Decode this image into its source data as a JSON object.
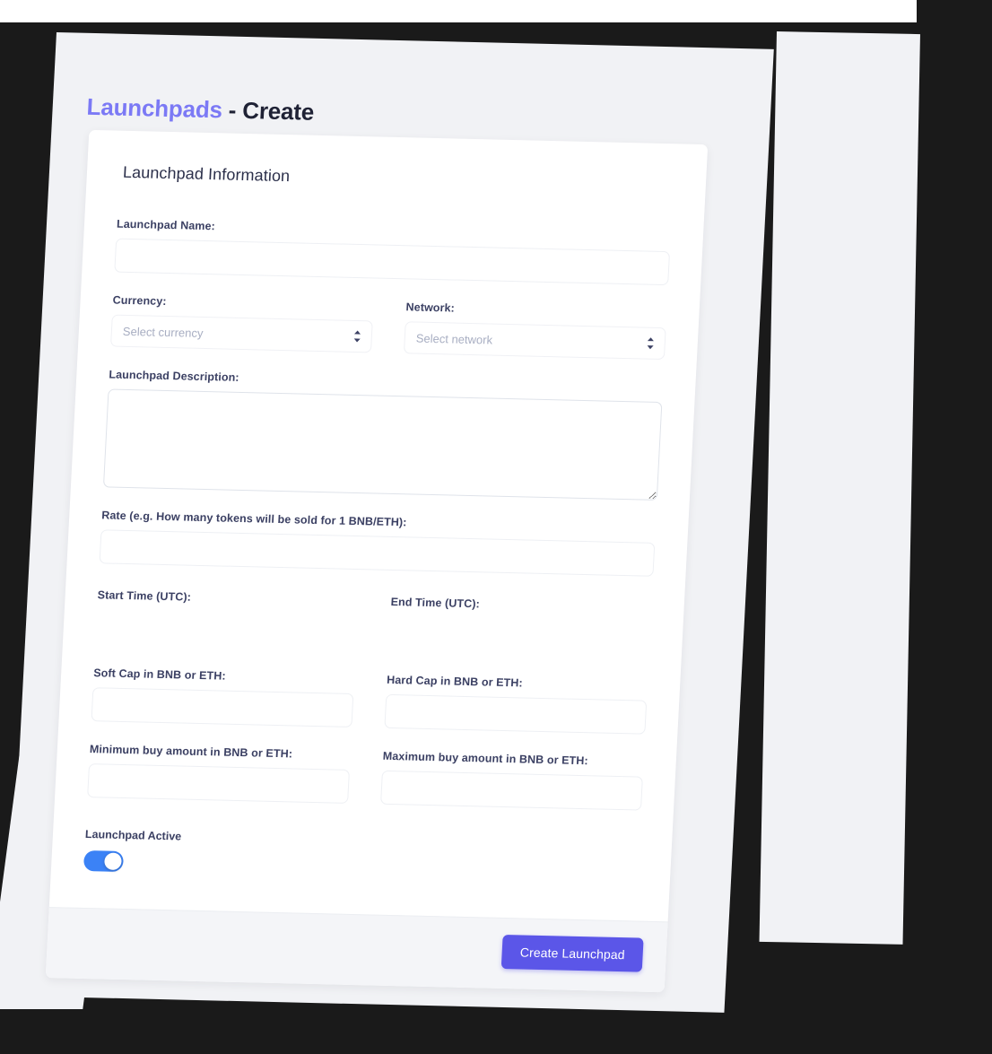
{
  "page": {
    "title_accent": "Launchpads",
    "title_rest": " - Create"
  },
  "card": {
    "heading": "Launchpad Information",
    "fields": {
      "name": {
        "label": "Launchpad Name:",
        "value": "",
        "placeholder": ""
      },
      "currency": {
        "label": "Currency:",
        "placeholder": "Select currency",
        "selected": "Select currency",
        "icon": "chevron-up-down-icon"
      },
      "network": {
        "label": "Network:",
        "placeholder": "Select network",
        "selected": "Select network",
        "icon": "chevron-up-down-icon"
      },
      "description": {
        "label": "Launchpad Description:",
        "value": "",
        "placeholder": ""
      },
      "rate": {
        "label": "Rate (e.g. How many tokens will be sold for 1 BNB/ETH):",
        "value": "",
        "placeholder": ""
      },
      "start_time": {
        "label": "Start Time (UTC):",
        "value": "",
        "placeholder": ""
      },
      "end_time": {
        "label": "End Time (UTC):",
        "value": "",
        "placeholder": ""
      },
      "soft_cap": {
        "label": "Soft Cap in BNB or ETH:",
        "value": "",
        "placeholder": ""
      },
      "hard_cap": {
        "label": "Hard Cap in BNB or ETH:",
        "value": "",
        "placeholder": ""
      },
      "min_buy": {
        "label": "Minimum buy amount in BNB or ETH:",
        "value": "",
        "placeholder": ""
      },
      "max_buy": {
        "label": "Maximum buy amount in BNB or ETH:",
        "value": "",
        "placeholder": ""
      },
      "active_toggle": {
        "label": "Launchpad Active",
        "state": "on"
      }
    },
    "footer": {
      "submit_label": "Create Launchpad"
    }
  },
  "colors": {
    "accent_purple": "#7b79f5",
    "button_purple": "#5b56e8",
    "toggle_blue": "#3b82f6",
    "page_background": "#f1f2f5",
    "frame_dark": "#1a1a1a",
    "card_white": "#ffffff",
    "footer_gray": "#f4f5f8",
    "label_text": "#3b4063",
    "placeholder_text": "#a8aec2"
  }
}
